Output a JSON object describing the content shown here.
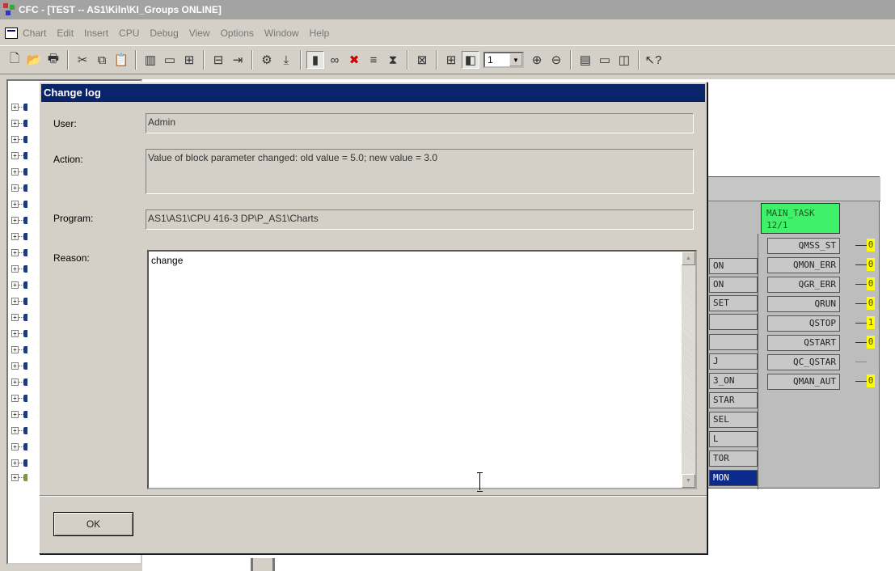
{
  "window": {
    "title": "CFC - [TEST -- AS1\\Kiln\\KI_Groups  ONLINE]"
  },
  "menu": {
    "items": [
      "Chart",
      "Edit",
      "Insert",
      "CPU",
      "Debug",
      "View",
      "Options",
      "Window",
      "Help"
    ]
  },
  "toolbar": {
    "zoom_value": "1"
  },
  "function_block": {
    "task_name": "MAIN_TASK",
    "task_seq": "12/1",
    "outputs": [
      {
        "name": "QMSS_ST",
        "value": "0"
      },
      {
        "name": "QMON_ERR",
        "value": "0"
      },
      {
        "name": "QGR_ERR",
        "value": "0"
      },
      {
        "name": "QRUN",
        "value": "0"
      },
      {
        "name": "QSTOP",
        "value": "1"
      },
      {
        "name": "QSTART",
        "value": "0"
      },
      {
        "name": "QC_QSTAR",
        "value": ""
      },
      {
        "name": "QMAN_AUT",
        "value": "0"
      }
    ],
    "inputs": [
      "ON",
      "ON",
      "SET",
      "",
      "",
      "J",
      "3_ON",
      "STAR",
      "SEL",
      "L",
      "TOR",
      "MON"
    ]
  },
  "dialog": {
    "title": "Change log",
    "user_label": "User:",
    "user_value": "Admin",
    "action_label": "Action:",
    "action_value": "Value of block parameter changed: old value = 5.0; new value = 3.0",
    "program_label": "Program:",
    "program_value": "AS1\\AS1\\CPU 416-3 DP\\P_AS1\\Charts",
    "reason_label": "Reason:",
    "reason_value": "change",
    "ok_label": "OK"
  }
}
